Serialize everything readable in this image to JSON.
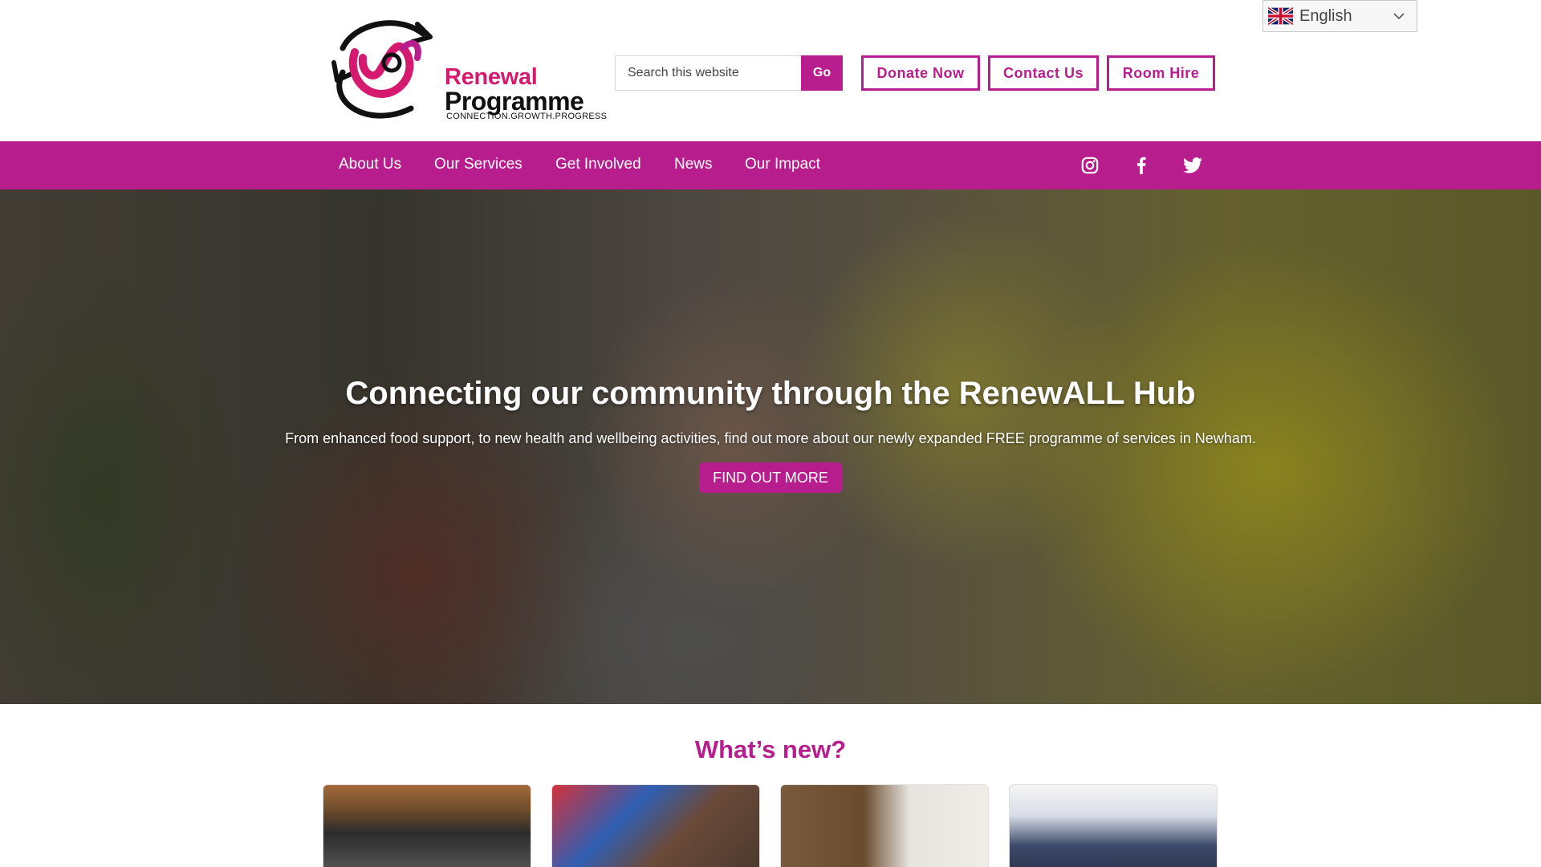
{
  "language_selector": {
    "label": "English",
    "flag_icon": "uk-flag-icon",
    "chevron_icon": "chevron-down-icon"
  },
  "brand": {
    "name_line1": "Renewal",
    "name_line2": "Programme",
    "tagline": "CONNECTION.GROWTH.PROGRESS",
    "accent_color": "#b71d8c",
    "logo_pink": "#d4196e"
  },
  "search": {
    "placeholder": "Search this website",
    "value": "",
    "button_label": "Go"
  },
  "header_buttons": {
    "donate": "Donate Now",
    "contact": "Contact Us",
    "room_hire": "Room Hire"
  },
  "nav": {
    "items": [
      {
        "label": "About Us"
      },
      {
        "label": "Our Services"
      },
      {
        "label": "Get Involved"
      },
      {
        "label": "News"
      },
      {
        "label": "Our Impact"
      }
    ],
    "social": [
      "instagram-icon",
      "facebook-icon",
      "twitter-icon"
    ]
  },
  "hero": {
    "title": "Connecting our community through the RenewALL Hub",
    "subtitle": "From enhanced food support, to new health and wellbeing activities, find out more about our newly expanded FREE programme of services in Newham.",
    "cta_label": "FIND OUT MORE"
  },
  "whats_new": {
    "title": "What’s new?"
  }
}
